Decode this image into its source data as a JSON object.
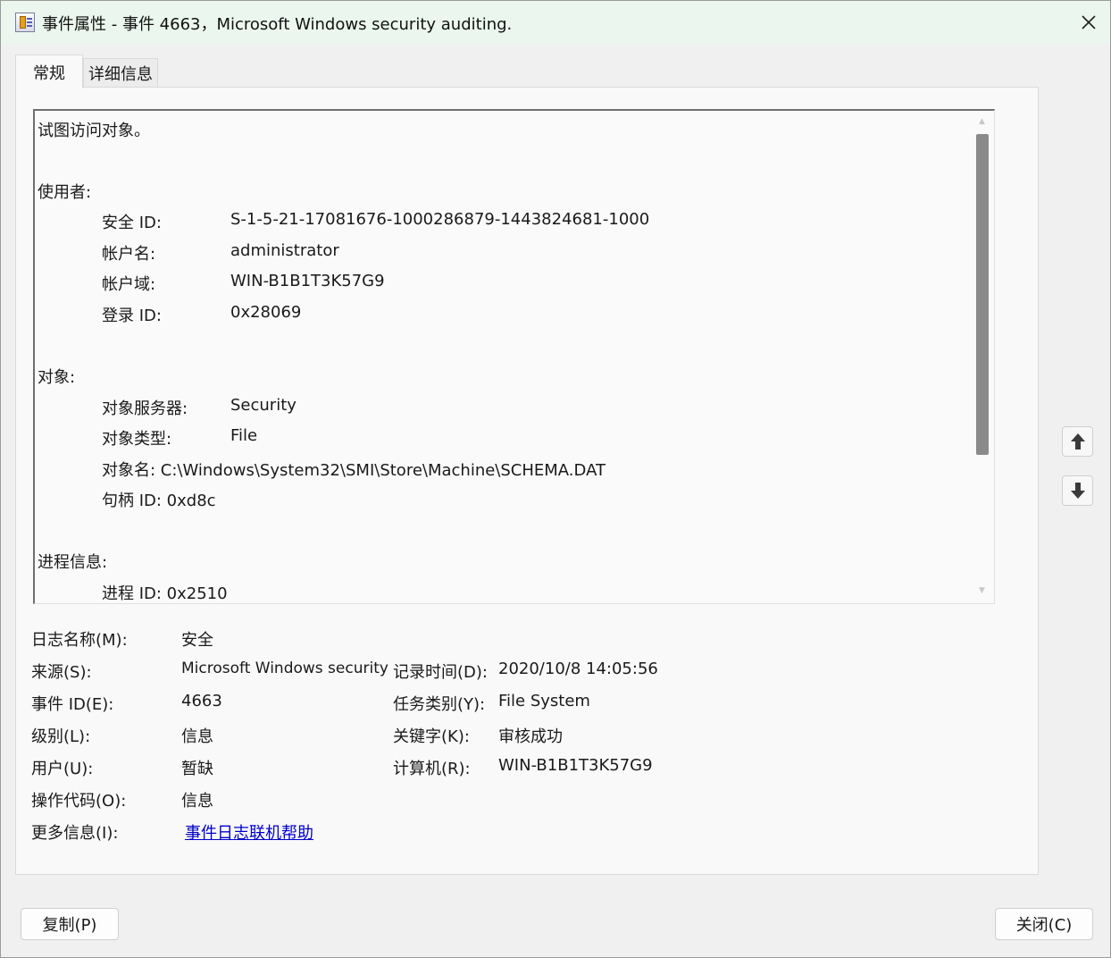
{
  "window": {
    "title": "事件属性 - 事件 4663，Microsoft Windows security auditing."
  },
  "tabs": [
    {
      "label": "常规"
    },
    {
      "label": "详细信息"
    }
  ],
  "description": {
    "lines": [
      "试图访问对象。",
      "使用者:",
      "安全 ID:",
      "S-1-5-21-17081676-1000286879-1443824681-1000",
      "帐户名:",
      "administrator",
      "帐户域:",
      "WIN-B1B1T3K57G9",
      "登录 ID:",
      "0x28069",
      "对象:",
      "对象服务器:",
      "Security",
      "对象类型:",
      "File",
      "对象名:   C:\\Windows\\System32\\SMI\\Store\\Machine\\SCHEMA.DAT",
      "句柄 ID: 0xd8c",
      "进程信息:",
      "进程 ID: 0x2510"
    ]
  },
  "fields": {
    "log_name_label": "日志名称(M):",
    "log_name_value": "安全",
    "source_label": "来源(S):",
    "source_value": "Microsoft Windows security",
    "logged_label": "记录时间(D):",
    "logged_value": "2020/10/8 14:05:56",
    "event_id_label": "事件 ID(E):",
    "event_id_value": "4663",
    "task_category_label": "任务类别(Y):",
    "task_category_value": "File System",
    "level_label": "级别(L):",
    "level_value": "信息",
    "keywords_label": "关键字(K):",
    "keywords_value": "审核成功",
    "user_label": "用户(U):",
    "user_value": "暂缺",
    "computer_label": "计算机(R):",
    "computer_value": "WIN-B1B1T3K57G9",
    "opcode_label": "操作代码(O):",
    "opcode_value": "信息",
    "more_info_label": "更多信息(I):",
    "more_info_link": "事件日志联机帮助"
  },
  "buttons": {
    "copy": "复制(P)",
    "close": "关闭(C)"
  },
  "icons": {
    "app": "event-properties-icon",
    "close": "close-icon",
    "up": "arrow-up-icon",
    "down": "arrow-down-icon"
  }
}
